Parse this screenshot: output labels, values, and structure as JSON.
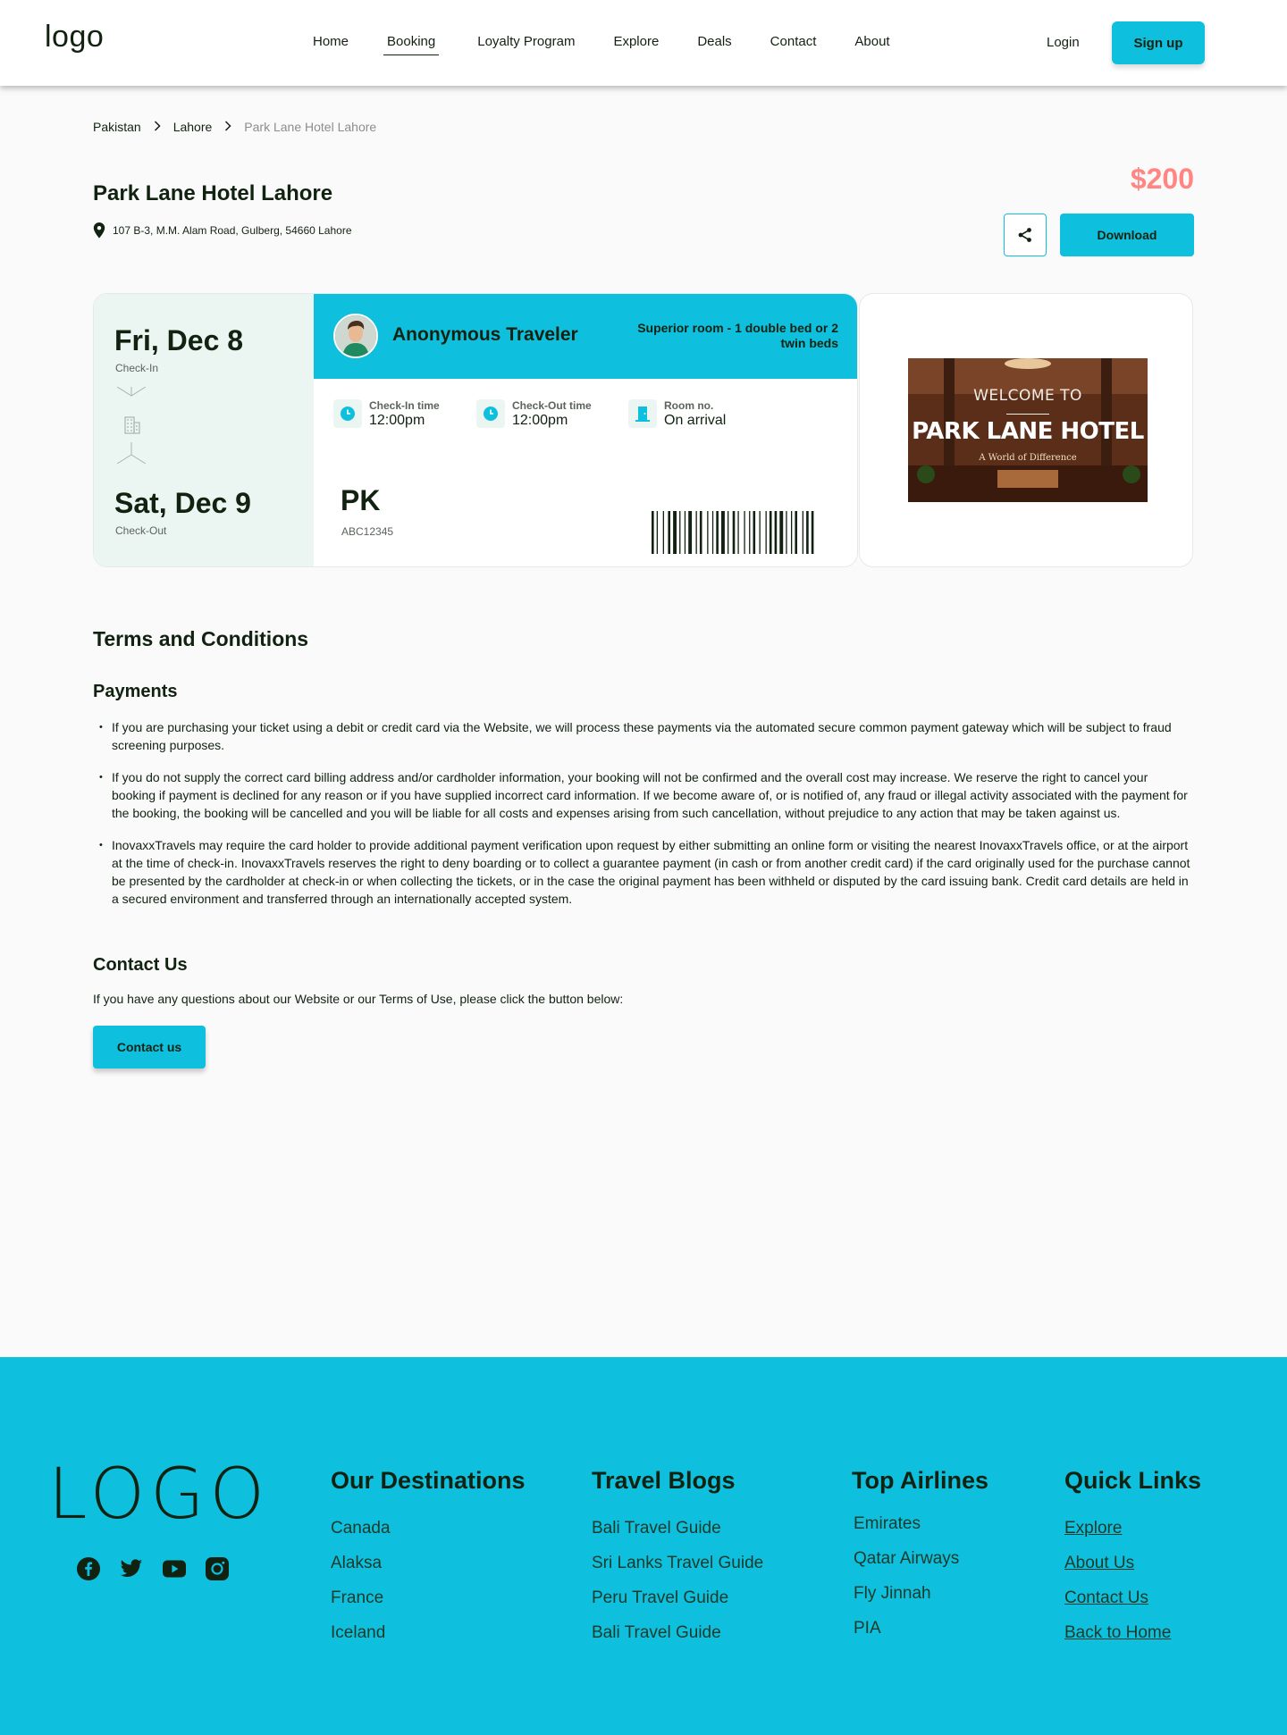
{
  "header": {
    "logo": "logo",
    "nav": [
      "Home",
      "Booking",
      "Loyalty Program",
      "Explore",
      "Deals",
      "Contact",
      "About"
    ],
    "active_nav": "Booking",
    "login": "Login",
    "signup": "Sign up"
  },
  "breadcrumb": [
    "Pakistan",
    "Lahore",
    "Park Lane Hotel Lahore"
  ],
  "hotel": {
    "name": "Park Lane Hotel Lahore",
    "address": "107 B-3, M.M. Alam Road, Gulberg, 54660 Lahore",
    "price": "$200",
    "download": "Download"
  },
  "ticket": {
    "checkin_date": "Fri, Dec 8",
    "checkin_label": "Check-In",
    "checkout_date": "Sat, Dec 9",
    "checkout_label": "Check-Out",
    "traveler": "Anonymous Traveler",
    "room_type": "Superior room - 1 double bed or 2 twin beds",
    "checkin_time_label": "Check-In time",
    "checkin_time": "12:00pm",
    "checkout_time_label": "Check-Out time",
    "checkout_time": "12:00pm",
    "room_label": "Room no.",
    "room_value": "On arrival",
    "code": "PK",
    "code_small": "ABC12345"
  },
  "photo": {
    "welcome": "WELCOME TO",
    "name": "PARK LANE HOTEL",
    "tagline": "A World of Difference"
  },
  "terms": {
    "title": "Terms and Conditions",
    "payments_title": "Payments",
    "items": [
      "If you are purchasing your ticket using a debit or credit card via the Website, we will process these payments via the automated secure common payment gateway which will be subject to fraud screening purposes.",
      "If you do not supply the correct card billing address and/or cardholder information, your booking will not be confirmed and the overall cost may increase. We reserve the right to cancel your booking if payment is declined for any reason or if you have supplied incorrect card information. If we become aware of, or is notified of, any fraud or illegal activity associated with the payment for the booking, the booking will be cancelled and you will be liable for all costs and expenses arising from such cancellation, without prejudice to any action that may be taken against us.",
      "InovaxxTravels may require the card holder to provide additional payment verification upon request by either submitting an online form or visiting the nearest InovaxxTravels office, or at the airport at the time of check-in. InovaxxTravels reserves the right to deny boarding or to collect a guarantee payment (in cash or from another credit card) if the card originally used for the purchase cannot be presented by the cardholder at check-in or when collecting the tickets, or in the case the original payment has been withheld or disputed by the card issuing bank. Credit card details are held in a secured environment and transferred through an internationally accepted system."
    ],
    "contact_title": "Contact Us",
    "contact_text": "If you have any questions about our Website or our Terms of Use, please click the button below:",
    "contact_button": "Contact us"
  },
  "footer": {
    "logo": "LOGO",
    "socials": [
      "facebook-icon",
      "twitter-icon",
      "youtube-icon",
      "instagram-icon"
    ],
    "destinations": {
      "title": "Our Destinations",
      "items": [
        "Canada",
        "Alaksa",
        "France",
        "Iceland"
      ]
    },
    "blogs": {
      "title": "Travel Blogs",
      "items": [
        "Bali Travel Guide",
        "Sri Lanks Travel Guide",
        "Peru Travel Guide",
        "Bali Travel Guide"
      ]
    },
    "airlines": {
      "title": "Top Airlines",
      "items": [
        "Emirates",
        "Qatar Airways",
        "Fly Jinnah",
        "PIA"
      ]
    },
    "quick": {
      "title": "Quick Links",
      "items": [
        "Explore",
        "About Us",
        "Contact Us",
        "Back to Home"
      ]
    }
  },
  "colors": {
    "accent": "#0ebfde",
    "price": "#ff8682",
    "mint": "#ebf6f2",
    "text": "#112211"
  }
}
